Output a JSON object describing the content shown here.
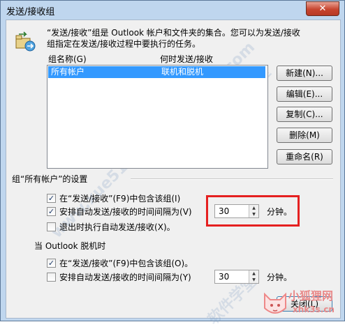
{
  "window": {
    "title": "发送/接收组",
    "close_glyph": "✕"
  },
  "intro": {
    "line1": "“发送/接收”组是 Outlook 帐户和文件夹的集合。您可以为发送/接收",
    "line2": "组指定在发送/接收过程中要执行的任务。"
  },
  "list": {
    "col_name": "组名称(G)",
    "col_when": "何时发送/接收",
    "rows": [
      {
        "name": "所有帐户",
        "when": "联机和脱机"
      }
    ]
  },
  "buttons": {
    "new": "新建(N)...",
    "edit": "编辑(E)...",
    "copy": "复制(C)...",
    "delete": "删除(M)",
    "rename": "重命名(R)",
    "close": "关闭(L)"
  },
  "settings": {
    "group_title": "组“所有帐户”的设置",
    "online": {
      "include_label": "在“发送/接收”(F9)中包含该组(I)",
      "include_checked": true,
      "auto_label": "安排自动发送/接收的时间间隔为(V)",
      "auto_checked": true,
      "auto_minutes": "30",
      "minutes_unit": "分钟。",
      "exit_label": "退出时执行自动发送/接收(X)。",
      "exit_checked": false
    },
    "offline_title": "当 Outlook 脱机时",
    "offline": {
      "include_label": "在“发送/接收”(F9)中包含该组(O)。",
      "include_checked": true,
      "auto_label": "安排自动发送/接收的时间间隔为(Y)",
      "auto_checked": false,
      "auto_minutes": "30",
      "minutes_unit": "分钟。"
    }
  },
  "check_glyph": "✓",
  "watermarks": [
    "www.xue51.com",
    "软件学堂",
    "小狐狸网",
    "xhk3s.cn"
  ],
  "icons": [
    "send-receive-icon",
    "close-icon",
    "spin-up-icon",
    "spin-down-icon",
    "fox-logo-icon"
  ],
  "colors": {
    "highlight": "#3399ff",
    "annotation_box": "#e52020",
    "chrome": "#bfd6ee"
  }
}
